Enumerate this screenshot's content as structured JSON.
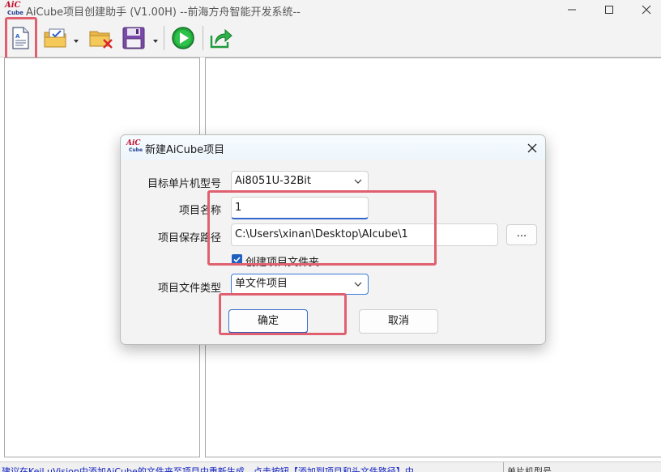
{
  "window": {
    "logo_top": "AiC",
    "logo_bottom": "Cube",
    "title": "AiCube项目创建助手 (V1.00H) --前海方舟智能开发系统--"
  },
  "toolbar": {
    "buttons": [
      {
        "icon": "new-project-icon"
      },
      {
        "icon": "open-project-icon"
      },
      {
        "icon": "close-project-icon"
      },
      {
        "icon": "save-project-icon"
      },
      {
        "icon": "run-icon"
      },
      {
        "icon": "export-icon"
      }
    ]
  },
  "status_bar": {
    "message": "建议在Keil uVision中添加AiCube的文件夹至项目中重新生成，点击按钮【添加到项目和头文件路径】中",
    "mcu_label": "单片机型号"
  },
  "dialog": {
    "logo_top": "AiC",
    "logo_bottom": "Cube",
    "title": "新建AiCube项目",
    "mcu_label": "目标单片机型号",
    "mcu_value": "Ai8051U-32Bit",
    "name_label": "项目名称",
    "name_value": "1",
    "path_label": "项目保存路径",
    "path_value": "C:\\Users\\xinan\\Desktop\\AIcube\\1",
    "browse_label": "...",
    "create_folder_label": "创建项目文件夹",
    "create_folder_checked": true,
    "type_label": "项目文件类型",
    "type_value": "单文件项目",
    "ok_label": "确定",
    "cancel_label": "取消"
  },
  "colors": {
    "highlight": "#e06070",
    "accent": "#1f5fbf",
    "status_text": "#1020c0"
  }
}
